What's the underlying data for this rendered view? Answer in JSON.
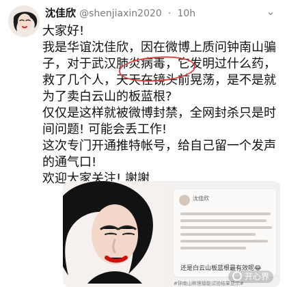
{
  "tweet": {
    "display_name": "沈佳欣",
    "handle": "@shenjiaxin2020",
    "dot": "·",
    "time": "10h",
    "more_icon": "chevron-down-icon",
    "body": "大家好!\n我是华谊沈佳欣，因在微博上质问钟南山骗子，对于武汉肺炎病毒，它发明过什么药，救了几个人，天天在镜头前晃荡，是不是就为了卖白云山的板蓝根?\n仅仅是这样就被微博封禁，全网封杀只是时间问题! 可能会丢工作!\n这次专门开通推特帐号，给自己留一个发声的通气口!\n欢迎大家关注! 謝謝"
  },
  "embedded_screenshot": {
    "name": "沈佳欣",
    "footer": "还是白云山板蓝根最有效呢😂",
    "bottom": "#钟南山称理接能试验结果显示#"
  },
  "watermark": {
    "text": "开心界"
  }
}
